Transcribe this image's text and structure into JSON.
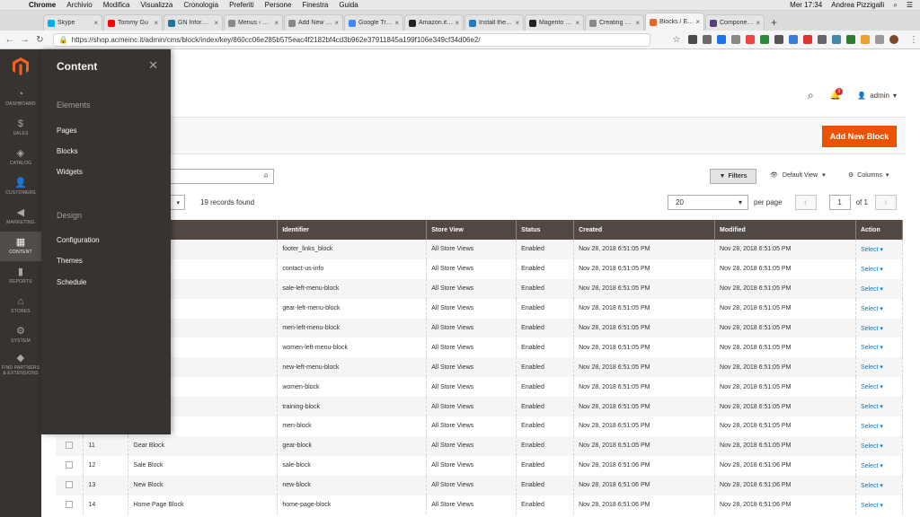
{
  "mac_menu": {
    "app": "Chrome",
    "items": [
      "Archivio",
      "Modifica",
      "Visualizza",
      "Cronologia",
      "Preferiti",
      "Persone",
      "Finestra",
      "Guida"
    ],
    "clock": "Mer 17:34",
    "user": "Andrea Pizzigalli"
  },
  "tabs": [
    {
      "title": "Skype",
      "color": "#00aff0"
    },
    {
      "title": "Tommy Gu",
      "color": "#ff0000"
    },
    {
      "title": "GN Information",
      "color": "#21759b"
    },
    {
      "title": "Menus ‹ GN In",
      "color": "#888888"
    },
    {
      "title": "Add New Post",
      "color": "#888888"
    },
    {
      "title": "Google Tradu",
      "color": "#4285f4"
    },
    {
      "title": "Amazon.it: Vi",
      "color": "#222222"
    },
    {
      "title": "Install the Ma",
      "color": "#1e7bc5"
    },
    {
      "title": "Magento 2: Hi",
      "color": "#222222"
    },
    {
      "title": "Creating Block",
      "color": "#888888"
    },
    {
      "title": "Blocks / Eleme",
      "color": "#f26322",
      "active": true
    },
    {
      "title": "Components",
      "color": "#563d7c"
    }
  ],
  "address": {
    "url": "https://shop.acmeinc.it/admin/cms/block/index/key/860cc06e285b575eac4f2182bf4cd3b962e37911845a199f106e349cf34d06e2/"
  },
  "sidenav": [
    {
      "icon": "dashboard-icon",
      "glyph": "◔",
      "label": "DASHBOARD"
    },
    {
      "icon": "dollar-icon",
      "glyph": "$",
      "label": "SALES"
    },
    {
      "icon": "cube-icon",
      "glyph": "◈",
      "label": "CATALOG"
    },
    {
      "icon": "people-icon",
      "glyph": "👤",
      "label": "CUSTOMERS"
    },
    {
      "icon": "megaphone-icon",
      "glyph": "◀",
      "label": "MARKETING"
    },
    {
      "icon": "content-icon",
      "glyph": "▦",
      "label": "CONTENT",
      "active": true
    },
    {
      "icon": "reports-icon",
      "glyph": "▮",
      "label": "REPORTS"
    },
    {
      "icon": "store-icon",
      "glyph": "⌂",
      "label": "STORES"
    },
    {
      "icon": "gear-icon",
      "glyph": "⚙",
      "label": "SYSTEM"
    },
    {
      "icon": "extensions-icon",
      "glyph": "◆",
      "label": "FIND PARTNERS & EXTENSIONS"
    }
  ],
  "flyout": {
    "title": "Content",
    "sections": [
      {
        "title": "Elements",
        "links": [
          "Pages",
          "Blocks",
          "Widgets"
        ]
      },
      {
        "title": "Design",
        "links": [
          "Configuration",
          "Themes",
          "Schedule"
        ]
      }
    ]
  },
  "header": {
    "admin_label": "admin",
    "notifications": "3"
  },
  "toolbar": {
    "add_new": "Add New Block",
    "filters": "Filters",
    "default_view": "Default View",
    "columns": "Columns",
    "records": "19 records found",
    "page_size": "20",
    "per_page": "per page",
    "page": "1",
    "of_pages": "of 1"
  },
  "table": {
    "headers": [
      "",
      "",
      "",
      "Identifier",
      "Store View",
      "Status",
      "Created",
      "Modified",
      "Action"
    ],
    "rows": [
      {
        "id": "",
        "title": "Block",
        "identifier": "footer_links_block",
        "store": "All Store Views",
        "status": "Enabled",
        "created": "Nov 28, 2018 6:51:05 PM",
        "modified": "Nov 28, 2018 6:51:05 PM",
        "action": "Select"
      },
      {
        "id": "",
        "title": "o",
        "identifier": "contact-us-info",
        "store": "All Store Views",
        "status": "Enabled",
        "created": "Nov 28, 2018 6:51:05 PM",
        "modified": "Nov 28, 2018 6:51:05 PM",
        "action": "Select"
      },
      {
        "id": "",
        "title": "u Block",
        "identifier": "sale-left-menu-block",
        "store": "All Store Views",
        "status": "Enabled",
        "created": "Nov 28, 2018 6:51:05 PM",
        "modified": "Nov 28, 2018 6:51:05 PM",
        "action": "Select"
      },
      {
        "id": "",
        "title": "u Block",
        "identifier": "gear-left-menu-block",
        "store": "All Store Views",
        "status": "Enabled",
        "created": "Nov 28, 2018 6:51:05 PM",
        "modified": "Nov 28, 2018 6:51:05 PM",
        "action": "Select"
      },
      {
        "id": "",
        "title": "u Block",
        "identifier": "men-left-menu-block",
        "store": "All Store Views",
        "status": "Enabled",
        "created": "Nov 28, 2018 6:51:05 PM",
        "modified": "Nov 28, 2018 6:51:05 PM",
        "action": "Select"
      },
      {
        "id": "",
        "title": "Menu Block",
        "identifier": "women-left-menu-block",
        "store": "All Store Views",
        "status": "Enabled",
        "created": "Nov 28, 2018 6:51:05 PM",
        "modified": "Nov 28, 2018 6:51:05 PM",
        "action": "Select"
      },
      {
        "id": "",
        "title": "u Block",
        "identifier": "new-left-menu-block",
        "store": "All Store Views",
        "status": "Enabled",
        "created": "Nov 28, 2018 6:51:05 PM",
        "modified": "Nov 28, 2018 6:51:05 PM",
        "action": "Select"
      },
      {
        "id": "",
        "title": "",
        "identifier": "women-block",
        "store": "All Store Views",
        "status": "Enabled",
        "created": "Nov 28, 2018 6:51:05 PM",
        "modified": "Nov 28, 2018 6:51:05 PM",
        "action": "Select"
      },
      {
        "id": "",
        "title": "",
        "identifier": "training-block",
        "store": "All Store Views",
        "status": "Enabled",
        "created": "Nov 28, 2018 6:51:05 PM",
        "modified": "Nov 28, 2018 6:51:05 PM",
        "action": "Select"
      },
      {
        "id": "",
        "title": "",
        "identifier": "men-block",
        "store": "All Store Views",
        "status": "Enabled",
        "created": "Nov 28, 2018 6:51:05 PM",
        "modified": "Nov 28, 2018 6:51:05 PM",
        "action": "Select"
      },
      {
        "id": "11",
        "title": "Gear Block",
        "identifier": "gear-block",
        "store": "All Store Views",
        "status": "Enabled",
        "created": "Nov 28, 2018 6:51:05 PM",
        "modified": "Nov 28, 2018 6:51:05 PM",
        "action": "Select"
      },
      {
        "id": "12",
        "title": "Sale Block",
        "identifier": "sale-block",
        "store": "All Store Views",
        "status": "Enabled",
        "created": "Nov 28, 2018 6:51:06 PM",
        "modified": "Nov 28, 2018 6:51:06 PM",
        "action": "Select"
      },
      {
        "id": "13",
        "title": "New Block",
        "identifier": "new-block",
        "store": "All Store Views",
        "status": "Enabled",
        "created": "Nov 28, 2018 6:51:06 PM",
        "modified": "Nov 28, 2018 6:51:06 PM",
        "action": "Select"
      },
      {
        "id": "14",
        "title": "Home Page Block",
        "identifier": "home-page-block",
        "store": "All Store Views",
        "status": "Enabled",
        "created": "Nov 28, 2018 6:51:06 PM",
        "modified": "Nov 28, 2018 6:51:06 PM",
        "action": "Select"
      }
    ]
  },
  "colors": {
    "accent": "#eb5202",
    "nav_bg": "#373330",
    "table_header": "#514943",
    "link": "#007bdb"
  }
}
